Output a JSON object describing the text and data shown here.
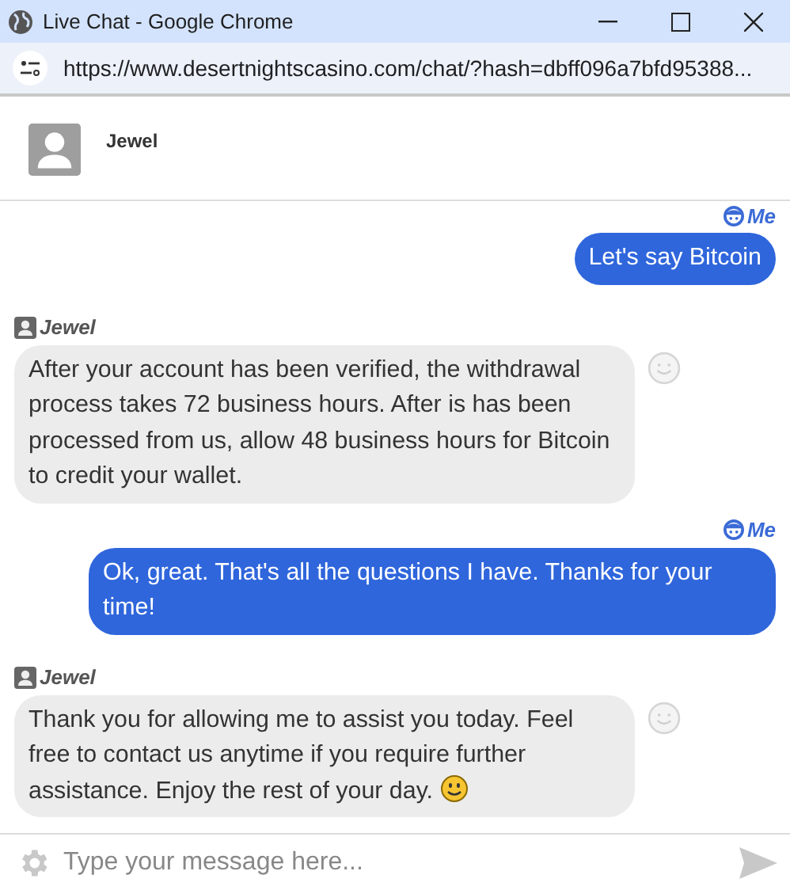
{
  "window": {
    "title": "Live Chat - Google Chrome",
    "url": "https://www.desertnightscasino.com/chat/?hash=dbff096a7bfd95388..."
  },
  "header": {
    "agent_name": "Jewel"
  },
  "messages": [
    {
      "kind": "user",
      "sender": "Me",
      "text": "Let's say Bitcoin"
    },
    {
      "kind": "agent",
      "sender": "Jewel",
      "text": "After your account has been verified, the withdrawal process takes 72 business hours. After is has been processed from us, allow 48 business hours for Bitcoin to credit your wallet.",
      "emoji": false
    },
    {
      "kind": "user",
      "sender": "Me",
      "text": "Ok, great. That's all the questions I have. Thanks for your time!"
    },
    {
      "kind": "agent",
      "sender": "Jewel",
      "text": "Thank you for allowing me to assist you today. Feel free to contact us anytime if you require further assistance. Enjoy the rest of your day.",
      "emoji": true
    }
  ],
  "composer": {
    "placeholder": "Type your message here..."
  }
}
